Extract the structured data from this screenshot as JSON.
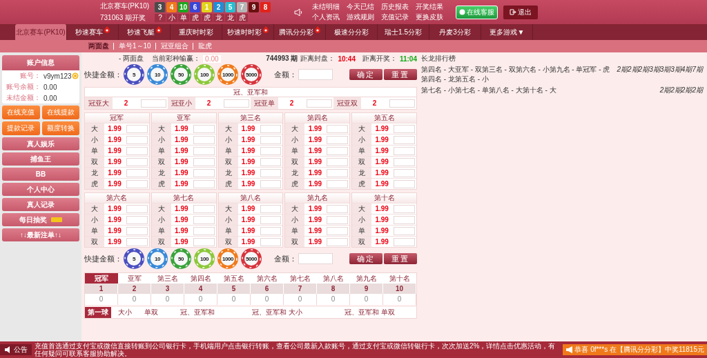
{
  "header": {
    "game": "北京赛车(PK10)",
    "draw": "731063 期开奖",
    "balls": [
      {
        "number": "3",
        "color": "#4a4a4a"
      },
      {
        "number": "4",
        "color": "#f07a1a"
      },
      {
        "number": "10",
        "color": "#1ea51e"
      },
      {
        "number": "6",
        "color": "#3b45d6"
      },
      {
        "number": "1",
        "color": "#e3d21c"
      },
      {
        "number": "2",
        "color": "#1f8ed6"
      },
      {
        "number": "5",
        "color": "#27bfcf"
      },
      {
        "number": "7",
        "color": "#b5b5b5"
      },
      {
        "number": "9",
        "color": "#6a1010"
      },
      {
        "number": "8",
        "color": "#e2231a"
      }
    ],
    "results": [
      "?",
      "小",
      "单",
      "虎",
      "虎",
      "龙",
      "龙",
      "虎"
    ],
    "links": [
      "未结明细",
      "今天已结",
      "历史报表",
      "开奖结果",
      "个人资讯",
      "游戏规则",
      "充值记录",
      "更换皮肤"
    ],
    "service": "在线客服",
    "logout": "退出"
  },
  "nav": [
    {
      "label": "北京赛车(PK10)",
      "selected": true,
      "hot": false
    },
    {
      "label": "秒速赛车",
      "selected": false,
      "hot": true
    },
    {
      "label": "秒速飞艇",
      "selected": false,
      "hot": true
    },
    {
      "label": "重庆时时彩",
      "selected": false,
      "hot": false
    },
    {
      "label": "秒速时时彩",
      "selected": false,
      "hot": true
    },
    {
      "label": "腾讯分分彩",
      "selected": false,
      "hot": true
    },
    {
      "label": "极速分分彩",
      "selected": false,
      "hot": false
    },
    {
      "label": "瑞士1.5分彩",
      "selected": false,
      "hot": false
    },
    {
      "label": "丹麦3分彩",
      "selected": false,
      "hot": false
    },
    {
      "label": "更多游戏",
      "selected": false,
      "hot": false,
      "caret": "▼"
    }
  ],
  "subnav": [
    {
      "label": "两面盘",
      "selected": true
    },
    {
      "label": "单号1～10",
      "selected": false
    },
    {
      "label": "冠亚组合",
      "selected": false
    },
    {
      "label": "龍虎",
      "selected": false
    }
  ],
  "account": {
    "title": "账户信息",
    "rows": [
      {
        "label": "账号：",
        "value": "v9ym123",
        "coin": true
      },
      {
        "label": "账号余额：",
        "value": "0.00",
        "coin": false
      },
      {
        "label": "未结金额：",
        "value": "0.00",
        "coin": false
      }
    ]
  },
  "actions": [
    "在线充值",
    "在线提款",
    "提款记录",
    "额度转换"
  ],
  "menu": [
    {
      "label": "真人娱乐",
      "badge": false
    },
    {
      "label": "捕鱼王",
      "badge": false
    },
    {
      "label": "BB",
      "badge": false
    },
    {
      "label": "个人中心",
      "badge": false
    },
    {
      "label": "真人记录",
      "badge": false
    },
    {
      "label": "每日抽奖",
      "badge": true
    },
    {
      "label": "↑↓最新注单↑↓",
      "badge": false
    }
  ],
  "status": {
    "mode": "- 两面盘",
    "pnl_label": "当前彩种输赢：",
    "pnl": "0.00",
    "issue": "744993 期",
    "close_label": "距离封盘：",
    "close": "10:44",
    "open_label": "距离开奖：",
    "open": "11:04"
  },
  "bet_bars": [
    {
      "label": "快捷金额：",
      "chips": [
        {
          "value": "5",
          "color": "#4a4fc0"
        },
        {
          "value": "10",
          "color": "#3a8ad8"
        },
        {
          "value": "50",
          "color": "#3aa33a"
        },
        {
          "value": "100",
          "color": "#8cc83a"
        },
        {
          "value": "1000",
          "color": "#f07a1a"
        },
        {
          "value": "5000",
          "color": "#d8343c"
        }
      ],
      "amount_label": "金额：",
      "confirm": "确定",
      "reset": "重置"
    },
    {
      "label": "快捷金额：",
      "chips": [
        {
          "value": "5",
          "color": "#4a4fc0"
        },
        {
          "value": "10",
          "color": "#3a8ad8"
        },
        {
          "value": "50",
          "color": "#3aa33a"
        },
        {
          "value": "100",
          "color": "#8cc83a"
        },
        {
          "value": "1000",
          "color": "#f07a1a"
        },
        {
          "value": "5000",
          "color": "#d8343c"
        }
      ],
      "amount_label": "金额：",
      "confirm": "确定",
      "reset": "重置"
    }
  ],
  "sum": {
    "title": "冠、亚军和",
    "cells": [
      {
        "label": "冠亚大",
        "odds": "2"
      },
      {
        "label": "冠亚小",
        "odds": "2"
      },
      {
        "label": "冠亚单",
        "odds": "2"
      },
      {
        "label": "冠亚双",
        "odds": "2"
      }
    ]
  },
  "groups": [
    {
      "title": "冠军",
      "rows": [
        {
          "label": "大",
          "odds": "1.99"
        },
        {
          "label": "小",
          "odds": "1.99"
        },
        {
          "label": "单",
          "odds": "1.99"
        },
        {
          "label": "双",
          "odds": "1.99"
        },
        {
          "label": "龙",
          "odds": "1.99"
        },
        {
          "label": "虎",
          "odds": "1.99"
        }
      ]
    },
    {
      "title": "亚军",
      "rows": [
        {
          "label": "大",
          "odds": "1.99"
        },
        {
          "label": "小",
          "odds": "1.99"
        },
        {
          "label": "单",
          "odds": "1.99"
        },
        {
          "label": "双",
          "odds": "1.99"
        },
        {
          "label": "龙",
          "odds": "1.99"
        },
        {
          "label": "虎",
          "odds": "1.99"
        }
      ]
    },
    {
      "title": "第三名",
      "rows": [
        {
          "label": "大",
          "odds": "1.99"
        },
        {
          "label": "小",
          "odds": "1.99"
        },
        {
          "label": "单",
          "odds": "1.99"
        },
        {
          "label": "双",
          "odds": "1.99"
        },
        {
          "label": "龙",
          "odds": "1.99"
        },
        {
          "label": "虎",
          "odds": "1.99"
        }
      ]
    },
    {
      "title": "第四名",
      "rows": [
        {
          "label": "大",
          "odds": "1.99"
        },
        {
          "label": "小",
          "odds": "1.99"
        },
        {
          "label": "单",
          "odds": "1.99"
        },
        {
          "label": "双",
          "odds": "1.99"
        },
        {
          "label": "龙",
          "odds": "1.99"
        },
        {
          "label": "虎",
          "odds": "1.99"
        }
      ]
    },
    {
      "title": "第五名",
      "rows": [
        {
          "label": "大",
          "odds": "1.99"
        },
        {
          "label": "小",
          "odds": "1.99"
        },
        {
          "label": "单",
          "odds": "1.99"
        },
        {
          "label": "双",
          "odds": "1.99"
        },
        {
          "label": "龙",
          "odds": "1.99"
        },
        {
          "label": "虎",
          "odds": "1.99"
        }
      ]
    },
    {
      "title": "第六名",
      "rows": [
        {
          "label": "大",
          "odds": "1.99"
        },
        {
          "label": "小",
          "odds": "1.99"
        },
        {
          "label": "单",
          "odds": "1.99"
        },
        {
          "label": "双",
          "odds": "1.99"
        }
      ]
    },
    {
      "title": "第七名",
      "rows": [
        {
          "label": "大",
          "odds": "1.99"
        },
        {
          "label": "小",
          "odds": "1.99"
        },
        {
          "label": "单",
          "odds": "1.99"
        },
        {
          "label": "双",
          "odds": "1.99"
        }
      ]
    },
    {
      "title": "第八名",
      "rows": [
        {
          "label": "大",
          "odds": "1.99"
        },
        {
          "label": "小",
          "odds": "1.99"
        },
        {
          "label": "单",
          "odds": "1.99"
        },
        {
          "label": "双",
          "odds": "1.99"
        }
      ]
    },
    {
      "title": "第九名",
      "rows": [
        {
          "label": "大",
          "odds": "1.99"
        },
        {
          "label": "小",
          "odds": "1.99"
        },
        {
          "label": "单",
          "odds": "1.99"
        },
        {
          "label": "双",
          "odds": "1.99"
        }
      ]
    },
    {
      "title": "第十名",
      "rows": [
        {
          "label": "大",
          "odds": "1.99"
        },
        {
          "label": "小",
          "odds": "1.99"
        },
        {
          "label": "单",
          "odds": "1.99"
        },
        {
          "label": "双",
          "odds": "1.99"
        }
      ]
    }
  ],
  "long_dragon": {
    "title": "长龙排行榜",
    "rows": [
      {
        "text": "第四名 - 大亚军 - 双第三名 - 双第六名 - 小第九名 - 单冠军 - 虎第四名 - 龙第五名 - 小",
        "streak": "2期2期2期3期3期3期4期7期"
      },
      {
        "text": "第七名 - 小第七名 - 单第八名 - 大第十名 - 大",
        "streak": "2期2期2期2期"
      }
    ]
  },
  "stats": {
    "tabs": [
      {
        "label": "冠军",
        "selected": true
      },
      {
        "label": "亚军",
        "selected": false
      },
      {
        "label": "第三名",
        "selected": false
      },
      {
        "label": "第四名",
        "selected": false
      },
      {
        "label": "第五名",
        "selected": false
      },
      {
        "label": "第六名",
        "selected": false
      },
      {
        "label": "第七名",
        "selected": false
      },
      {
        "label": "第八名",
        "selected": false
      },
      {
        "label": "第九名",
        "selected": false
      },
      {
        "label": "第十名",
        "selected": false
      }
    ],
    "numbers": [
      "1",
      "2",
      "3",
      "4",
      "5",
      "6",
      "7",
      "8",
      "9",
      "10"
    ],
    "counts": [
      "0",
      "0",
      "0",
      "0",
      "0",
      "0",
      "0",
      "0",
      "0",
      "0"
    ],
    "subtabs": [
      {
        "label": "第一球",
        "selected": true
      },
      {
        "label": "大小",
        "selected": false
      },
      {
        "label": "单双",
        "selected": false
      },
      {
        "label": "冠、亚军和",
        "selected": false
      },
      {
        "label": "冠、亚军和 大小",
        "selected": false
      },
      {
        "label": "冠、亚军和 单双",
        "selected": false
      }
    ]
  },
  "footer": {
    "label": "公告",
    "notice": "充值首选通过支付宝或微信直接转账到公司银行卡，手机端用户点击银行转账，查看公司最新入款账号，通过支付宝或微信转银行卡，次次加送2%，详情点击优惠活动，有任何疑问可联系客服协助解决。",
    "winner": "恭喜 0f***s 在【腾讯分分彩】中奖11815元"
  }
}
